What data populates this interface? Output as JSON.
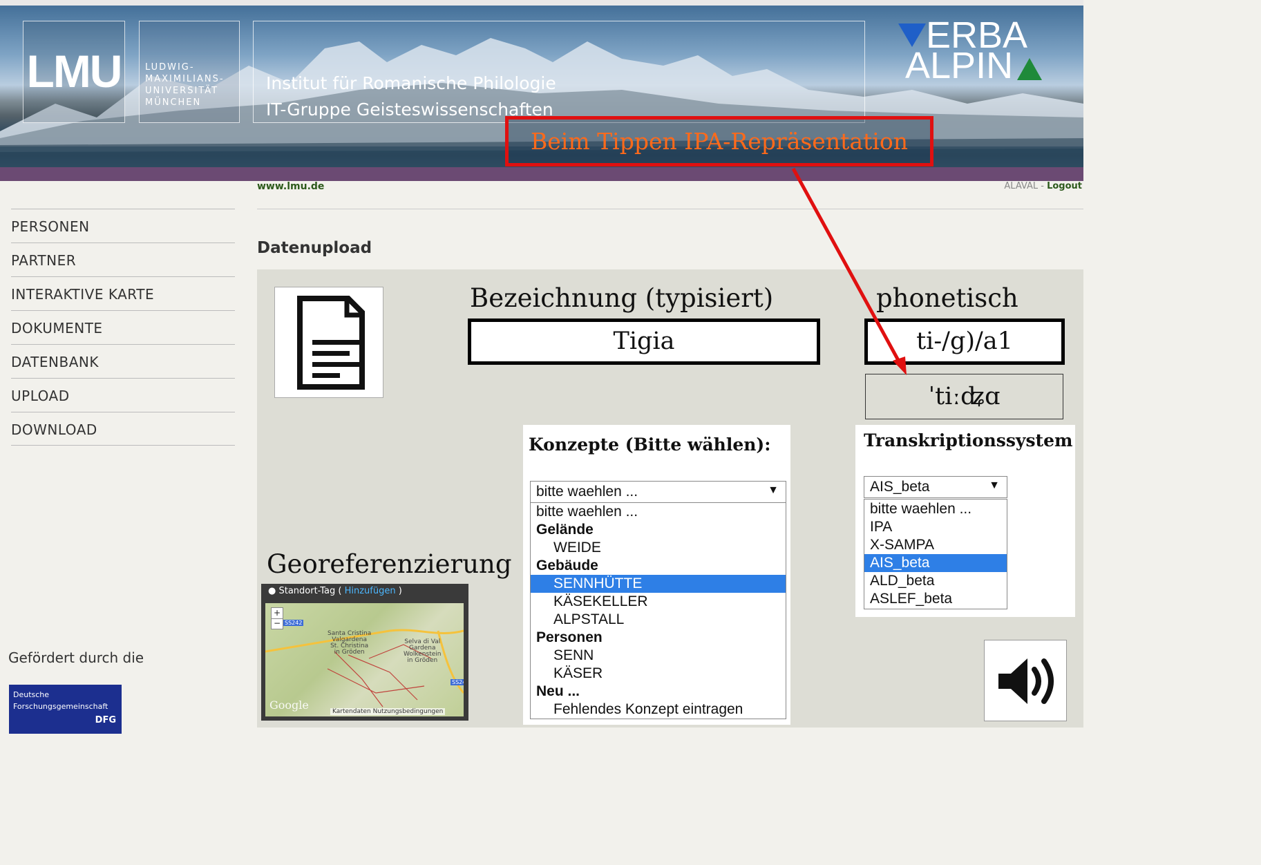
{
  "banner": {
    "lmu_logo": "LMU",
    "lmu_words": [
      "LUDWIG-",
      "MAXIMILIANS-",
      "UNIVERSITÄT",
      "MÜNCHEN"
    ],
    "institute_line1": "Institut für Romanische Philologie",
    "institute_line2": "IT-Gruppe Geisteswissenschaften",
    "project_logo_line1": "ERBA",
    "project_logo_line2": "ALPIN",
    "accent_blue": "#1f5fc8",
    "accent_green": "#1f8a3a"
  },
  "callout": {
    "text": "Beim Tippen IPA-Repräsentation",
    "color": "#e01010"
  },
  "header": {
    "site_link": "www.lmu.de",
    "user": "ALAVAL",
    "separator": " - ",
    "logout": "Logout"
  },
  "sidebar": {
    "items": [
      {
        "label": "PERSONEN"
      },
      {
        "label": "PARTNER"
      },
      {
        "label": "INTERAKTIVE KARTE"
      },
      {
        "label": "DOKUMENTE"
      },
      {
        "label": "DATENBANK"
      },
      {
        "label": "UPLOAD"
      },
      {
        "label": "DOWNLOAD"
      }
    ],
    "funded_by": "Gefördert durch die",
    "dfg_line1": "Deutsche",
    "dfg_line2": "Forschungsgemeinschaft",
    "dfg_abbr": "DFG"
  },
  "main": {
    "title": "Datenupload",
    "designation_label": "Bezeichnung (typisiert)",
    "designation_value": "Tigia",
    "phonetic_label": "phonetisch",
    "phonetic_value": "ti-/g)/a1",
    "ipa_value": "ˈtiːʥɑ",
    "concepts": {
      "title": "Konzepte (Bitte wählen):",
      "selected": "bitte waehlen ...",
      "options": [
        {
          "label": "bitte waehlen ...",
          "kind": "plain"
        },
        {
          "label": "Gelände",
          "kind": "group"
        },
        {
          "label": "WEIDE",
          "kind": "item"
        },
        {
          "label": "Gebäude",
          "kind": "group"
        },
        {
          "label": "SENNHÜTTE",
          "kind": "item",
          "highlighted": true
        },
        {
          "label": "KÄSEKELLER",
          "kind": "item"
        },
        {
          "label": "ALPSTALL",
          "kind": "item"
        },
        {
          "label": "Personen",
          "kind": "group"
        },
        {
          "label": "SENN",
          "kind": "item"
        },
        {
          "label": "KÄSER",
          "kind": "item"
        },
        {
          "label": "Neu ...",
          "kind": "group"
        },
        {
          "label": "Fehlendes Konzept eintragen",
          "kind": "item"
        }
      ]
    },
    "transcription": {
      "title": "Transkriptionssystem",
      "selected": "AIS_beta",
      "options": [
        {
          "label": "bitte waehlen ..."
        },
        {
          "label": "IPA"
        },
        {
          "label": "X-SAMPA"
        },
        {
          "label": "AIS_beta",
          "highlighted": true
        },
        {
          "label": "ALD_beta"
        },
        {
          "label": "ASLEF_beta"
        }
      ]
    },
    "georef": {
      "label": "Georeferenzierung",
      "tag_label": "Standort-Tag",
      "add_link": "Hinzufügen",
      "open_paren": "( ",
      "close_paren": " )",
      "map_places": [
        "Santa Cristina",
        "Valgardena",
        "St. Christina",
        "in Gröden",
        "Selva di Val",
        "Gardena",
        "Wolkenstein",
        "in Gröden"
      ],
      "road_labels": [
        "SS242",
        "SS24"
      ],
      "zoom_in": "+",
      "zoom_out": "−",
      "map_brand": "Google",
      "map_footer1": "Kartendaten",
      "map_footer2": "Nutzungsbedingungen"
    },
    "highlight_color": "#2e7fe6"
  }
}
